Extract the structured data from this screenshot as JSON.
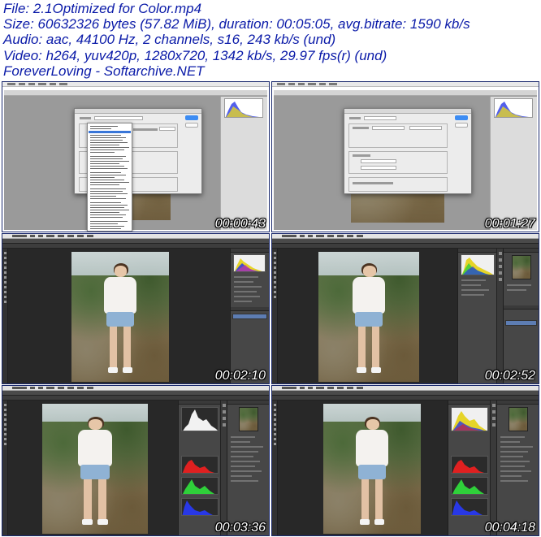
{
  "header": {
    "lines": [
      "File: 2.1Optimized for Color.mp4",
      "Size: 60632326 bytes (57.82 MiB), duration: 00:05:05, avg.bitrate: 1590 kb/s",
      "Audio: aac, 44100 Hz, 2 channels, s16, 243 kb/s (und)",
      "Video: h264, yuv420p, 1280x720, 1342 kb/s, 29.97 fps(r) (und)",
      "ForeverLoving - Softarchive.NET"
    ]
  },
  "thumbnails": [
    {
      "timestamp": "00:00:43",
      "view": "color-settings-dialog-dropdown"
    },
    {
      "timestamp": "00:01:27",
      "view": "color-settings-dialog"
    },
    {
      "timestamp": "00:02:10",
      "view": "photoshop-layers"
    },
    {
      "timestamp": "00:02:52",
      "view": "photoshop-histogram"
    },
    {
      "timestamp": "00:03:36",
      "view": "photoshop-rgb-channels"
    },
    {
      "timestamp": "00:04:18",
      "view": "photoshop-rgb-channels"
    }
  ],
  "colors": {
    "header_text": "#0a1aa8",
    "timestamp_text": "#ffffff",
    "hist_red": "#e02020",
    "hist_green": "#2fd03a",
    "hist_blue": "#2838e6",
    "hist_yellow": "#e6d428",
    "ps_dark": "#282828"
  }
}
